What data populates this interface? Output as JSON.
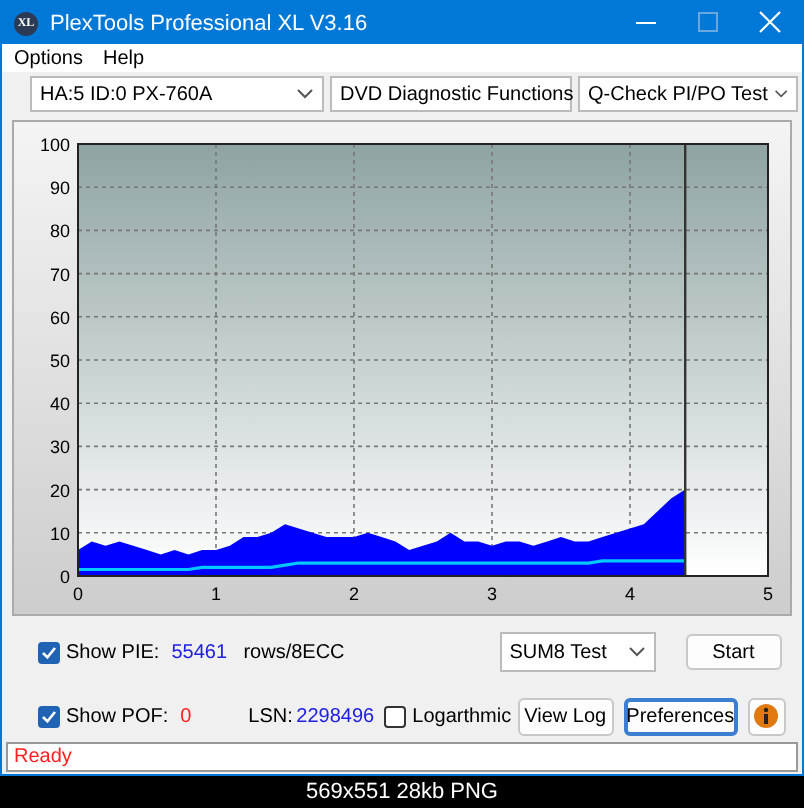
{
  "window": {
    "title": "PlexTools Professional XL V3.16",
    "app_icon_text": "XL"
  },
  "menu": [
    {
      "label": "Options"
    },
    {
      "label": "Help"
    }
  ],
  "selectors": [
    {
      "value": "HA:5 ID:0  PX-760A"
    },
    {
      "value": "DVD Diagnostic Functions"
    },
    {
      "value": "Q-Check PI/PO Test"
    }
  ],
  "chart": {
    "chart_data": {
      "type": "area",
      "xlim": [
        0,
        5
      ],
      "ylim": [
        0,
        100
      ],
      "xticks": [
        0,
        1,
        2,
        3,
        4,
        5
      ],
      "yticks": [
        0,
        10,
        20,
        30,
        40,
        50,
        60,
        70,
        80,
        90,
        100
      ],
      "grid": true,
      "ref_lines": [
        {
          "axis": "x",
          "value": 4.4
        }
      ],
      "x": [
        0,
        0.1,
        0.2,
        0.3,
        0.4,
        0.5,
        0.6,
        0.7,
        0.8,
        0.9,
        1,
        1.1,
        1.2,
        1.3,
        1.4,
        1.5,
        1.6,
        1.7,
        1.8,
        1.9,
        2,
        2.1,
        2.2,
        2.3,
        2.4,
        2.5,
        2.6,
        2.7,
        2.8,
        2.9,
        3,
        3.1,
        3.2,
        3.3,
        3.4,
        3.5,
        3.6,
        3.7,
        3.8,
        3.9,
        4,
        4.1,
        4.2,
        4.3,
        4.4
      ],
      "series": [
        {
          "type": "area",
          "color": "#0000ff",
          "values": [
            6,
            8,
            7,
            8,
            7,
            6,
            5,
            6,
            5,
            6,
            6,
            7,
            9,
            9,
            10,
            12,
            11,
            10,
            9,
            9,
            9,
            10,
            9,
            8,
            6,
            7,
            8,
            10,
            8,
            8,
            7,
            8,
            8,
            7,
            8,
            9,
            8,
            8,
            9,
            10,
            11,
            12,
            15,
            18,
            20
          ]
        },
        {
          "type": "line",
          "color": "#00c8ff",
          "values": [
            1.5,
            1.5,
            1.5,
            1.5,
            1.5,
            1.5,
            1.5,
            1.5,
            1.5,
            2,
            2,
            2,
            2,
            2,
            2,
            2.5,
            3,
            3,
            3,
            3,
            3,
            3,
            3,
            3,
            3,
            3,
            3,
            3,
            3,
            3,
            3,
            3,
            3,
            3,
            3,
            3,
            3,
            3,
            3.5,
            3.5,
            3.5,
            3.5,
            3.5,
            3.5,
            3.5
          ]
        }
      ]
    }
  },
  "show_pie": {
    "label": "Show PIE:",
    "checked": true,
    "value": "55461",
    "unit": "rows/8ECC"
  },
  "test_mode": {
    "value": "SUM8 Test"
  },
  "start_button": {
    "label": "Start"
  },
  "show_pof": {
    "label": "Show POF:",
    "checked": true,
    "value": "0"
  },
  "lsn": {
    "label": "LSN:",
    "value": "2298496"
  },
  "logarithmic": {
    "label": "Logarthmic",
    "checked": false
  },
  "buttons": [
    {
      "label": "View Log",
      "focused": false
    },
    {
      "label": "Preferences",
      "focused": true
    }
  ],
  "status_bar": {
    "text": "Ready"
  },
  "image_caption": "569x551 28kb PNG"
}
